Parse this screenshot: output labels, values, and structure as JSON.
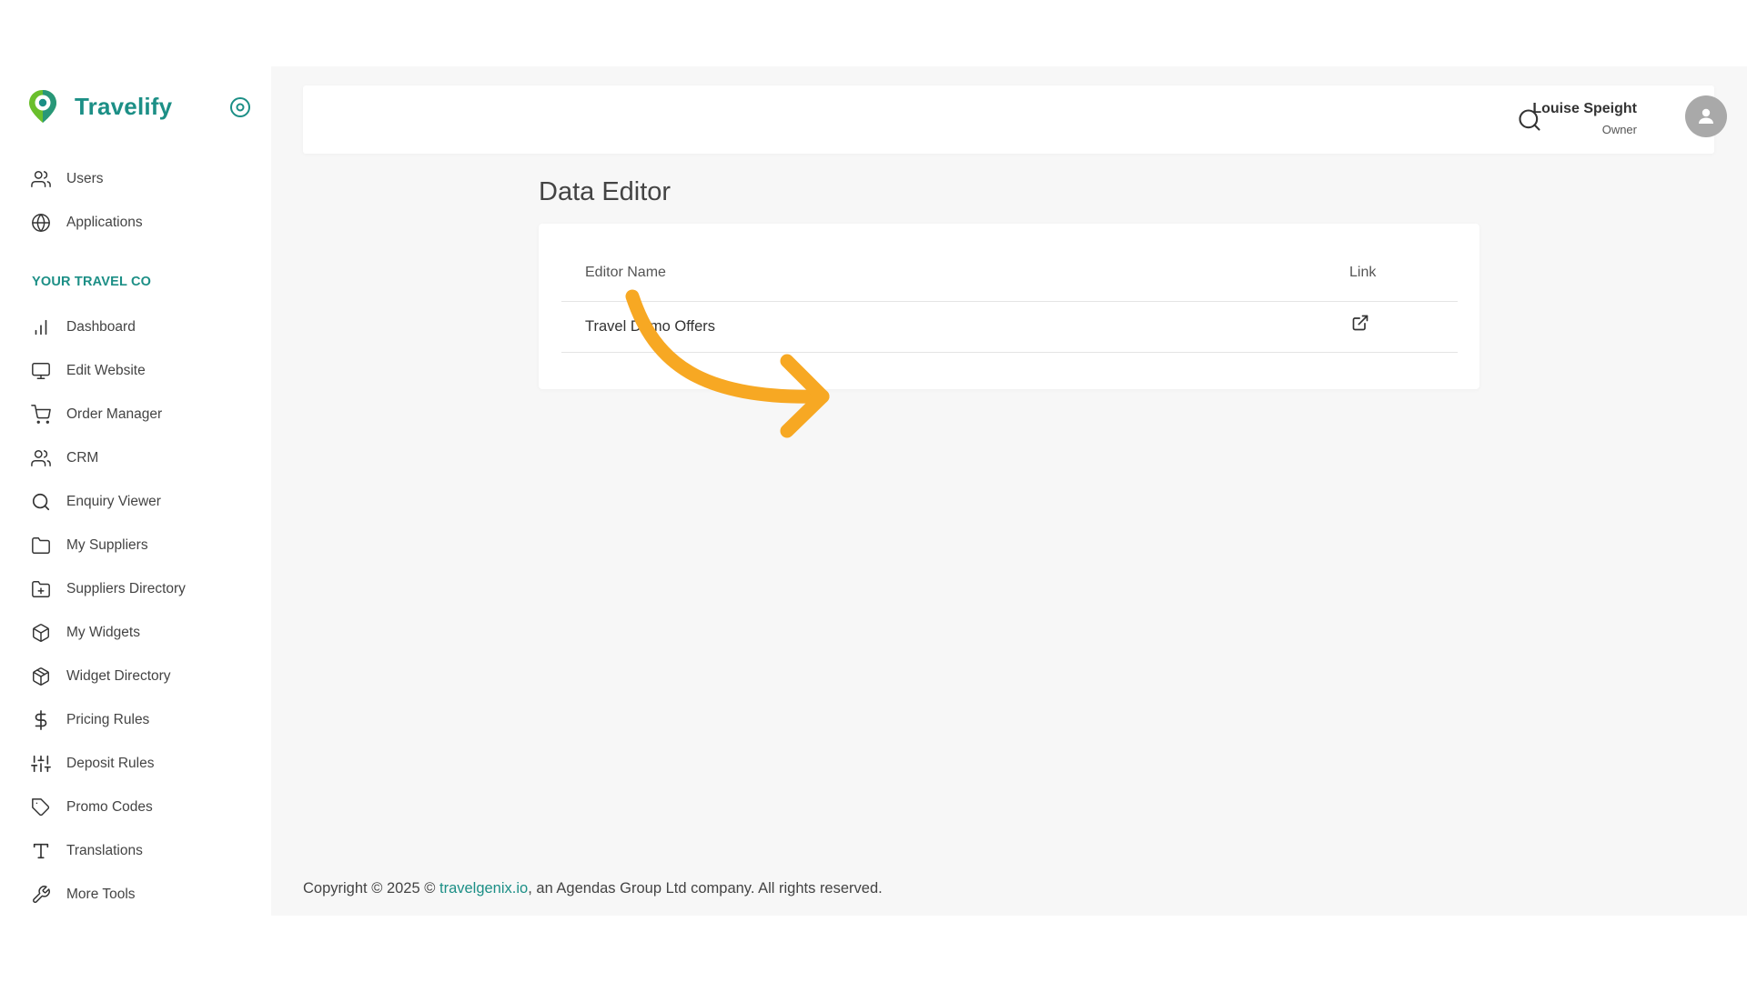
{
  "app": {
    "brand_name": "Travelify",
    "brand_color": "#1c8f86",
    "logo_green": "#6abf2c"
  },
  "sidebar": {
    "top_items": [
      {
        "label": "Users",
        "icon": "users-icon"
      },
      {
        "label": "Applications",
        "icon": "globe-icon"
      }
    ],
    "section_title": "YOUR TRAVEL CO",
    "items": [
      {
        "label": "Dashboard",
        "icon": "bar-chart-icon"
      },
      {
        "label": "Edit Website",
        "icon": "monitor-icon"
      },
      {
        "label": "Order Manager",
        "icon": "cart-icon"
      },
      {
        "label": "CRM",
        "icon": "users-icon"
      },
      {
        "label": "Enquiry Viewer",
        "icon": "search-icon"
      },
      {
        "label": "My Suppliers",
        "icon": "folder-icon"
      },
      {
        "label": "Suppliers Directory",
        "icon": "folder-plus-icon"
      },
      {
        "label": "My Widgets",
        "icon": "box-icon"
      },
      {
        "label": "Widget Directory",
        "icon": "package-icon"
      },
      {
        "label": "Pricing Rules",
        "icon": "dollar-icon"
      },
      {
        "label": "Deposit Rules",
        "icon": "sliders-icon"
      },
      {
        "label": "Promo Codes",
        "icon": "tag-icon"
      },
      {
        "label": "Translations",
        "icon": "type-icon"
      },
      {
        "label": "More Tools",
        "icon": "wrench-icon"
      }
    ]
  },
  "header": {
    "user_name": "Louise Speight",
    "user_role": "Owner"
  },
  "main": {
    "page_title": "Data Editor",
    "table": {
      "columns": [
        "Editor Name",
        "Link"
      ],
      "rows": [
        {
          "name": "Travel Demo Offers",
          "link_icon": "external-link-icon"
        }
      ]
    }
  },
  "footer": {
    "prefix": "Copyright © 2025 © ",
    "link_text": "travelgenix.io",
    "suffix": ", an Agendas Group Ltd company. All rights reserved."
  },
  "annotation": {
    "arrow_color": "#f7a823"
  }
}
